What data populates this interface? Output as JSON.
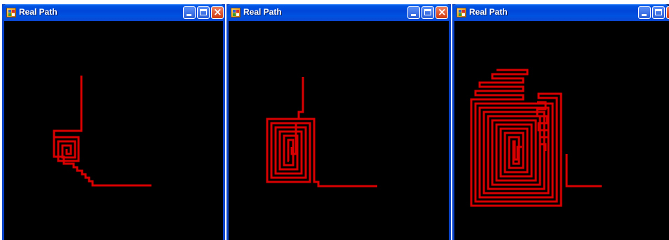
{
  "windows": [
    {
      "title": "Real Path",
      "controls": {
        "minimize_icon": "minimize-icon",
        "maximize_icon": "maximize-icon",
        "close_icon": "close-icon"
      }
    },
    {
      "title": "Real Path",
      "controls": {
        "minimize_icon": "minimize-icon",
        "maximize_icon": "maximize-icon",
        "close_icon": "close-icon"
      }
    },
    {
      "title": "Real Path",
      "controls": {
        "minimize_icon": "minimize-icon",
        "maximize_icon": "maximize-icon",
        "close_icon": "close-icon"
      }
    }
  ],
  "colors": {
    "path": "#d80000",
    "canvas": "#000000",
    "titlebar": "#0046d8"
  }
}
